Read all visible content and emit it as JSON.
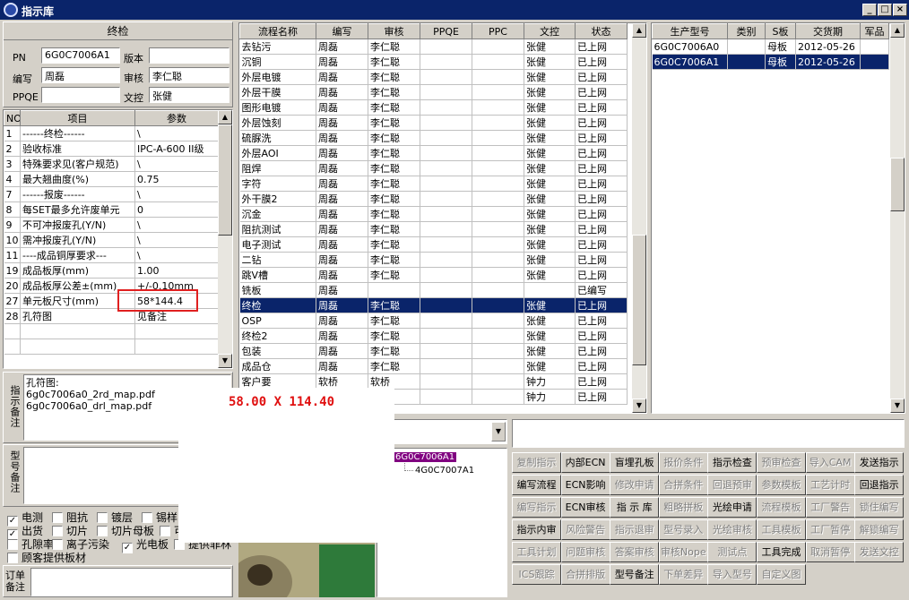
{
  "window": {
    "title": "指示库",
    "min": "_",
    "max": "□",
    "close": "×"
  },
  "left": {
    "section_title": "终检",
    "pn_label": "PN",
    "pn_value": "6G0C7006A1",
    "version_label": "版本",
    "version_value": "",
    "writer_label": "编写",
    "writer_value": "周磊",
    "review_label": "审核",
    "review_value": "李仁聪",
    "ppqe_label": "PPQE",
    "ppqe_value": "",
    "doc_label": "文控",
    "doc_value": "张健",
    "params_headers": [
      "NO",
      "项目",
      "参数"
    ],
    "params_rows": [
      [
        "1",
        "------终检------",
        "\\"
      ],
      [
        "2",
        "验收标准",
        "IPC-A-600 II级"
      ],
      [
        "3",
        "特殊要求见(客户规范)",
        "\\"
      ],
      [
        "4",
        "最大翘曲度(%)",
        "0.75"
      ],
      [
        "7",
        "------报废------",
        "\\"
      ],
      [
        "8",
        "每SET最多允许废单元",
        "0"
      ],
      [
        "9",
        "不可冲报废孔(Y/N)",
        "\\"
      ],
      [
        "10",
        "需冲报废孔(Y/N)",
        "\\"
      ],
      [
        "11",
        "----成品铜厚要求---",
        "\\"
      ],
      [
        "19",
        "成品板厚(mm)",
        "1.00"
      ],
      [
        "20",
        "成品板厚公差±(mm)",
        "+/-0.10mm"
      ],
      [
        "27",
        "单元板尺寸(mm)",
        "58*144.4"
      ],
      [
        "28",
        "孔符图",
        "见备注"
      ]
    ],
    "notes_label": "指示备注",
    "notes_lines": [
      "孔符图:",
      "6g0c7006a0_2rd_map.pdf",
      "6g0c7006a0_drl_map.pdf"
    ],
    "model_notes_label": "型号备注",
    "checkboxes_row1": [
      {
        "label": "电测",
        "checked": true
      },
      {
        "label": "阻抗",
        "checked": false
      },
      {
        "label": "镀层",
        "checked": false
      },
      {
        "label": "锡样",
        "checked": false
      }
    ],
    "checkboxes_row2": [
      {
        "label": "出货",
        "checked": true
      },
      {
        "label": "切片",
        "checked": false
      },
      {
        "label": "切片母板",
        "checked": false
      },
      {
        "label": "可",
        "checked": false
      }
    ],
    "checkboxes_row3": [
      {
        "label": "孔隙率",
        "checked": false
      },
      {
        "label": "离子污染",
        "checked": false
      },
      {
        "label": "光电板",
        "checked": true
      },
      {
        "label": "提供菲林",
        "checked": false
      }
    ],
    "checkbox_customer": {
      "label": "顾客提供板材",
      "checked": false
    },
    "order_notes_label": "订单备注"
  },
  "popup": {
    "text": "58.00 X 114.40"
  },
  "process": {
    "headers": [
      "流程名称",
      "编写",
      "审核",
      "PPQE",
      "PPC",
      "文控",
      "状态"
    ],
    "rows": [
      [
        "去钻污",
        "周磊",
        "李仁聪",
        "",
        "",
        "张健",
        "已上网"
      ],
      [
        "沉铜",
        "周磊",
        "李仁聪",
        "",
        "",
        "张健",
        "已上网"
      ],
      [
        "外层电镀",
        "周磊",
        "李仁聪",
        "",
        "",
        "张健",
        "已上网"
      ],
      [
        "外层干膜",
        "周磊",
        "李仁聪",
        "",
        "",
        "张健",
        "已上网"
      ],
      [
        "图形电镀",
        "周磊",
        "李仁聪",
        "",
        "",
        "张健",
        "已上网"
      ],
      [
        "外层蚀刻",
        "周磊",
        "李仁聪",
        "",
        "",
        "张健",
        "已上网"
      ],
      [
        "硫脲洗",
        "周磊",
        "李仁聪",
        "",
        "",
        "张健",
        "已上网"
      ],
      [
        "外层AOI",
        "周磊",
        "李仁聪",
        "",
        "",
        "张健",
        "已上网"
      ],
      [
        "阻焊",
        "周磊",
        "李仁聪",
        "",
        "",
        "张健",
        "已上网"
      ],
      [
        "字符",
        "周磊",
        "李仁聪",
        "",
        "",
        "张健",
        "已上网"
      ],
      [
        "外干膜2",
        "周磊",
        "李仁聪",
        "",
        "",
        "张健",
        "已上网"
      ],
      [
        "沉金",
        "周磊",
        "李仁聪",
        "",
        "",
        "张健",
        "已上网"
      ],
      [
        "阻抗测试",
        "周磊",
        "李仁聪",
        "",
        "",
        "张健",
        "已上网"
      ],
      [
        "电子测试",
        "周磊",
        "李仁聪",
        "",
        "",
        "张健",
        "已上网"
      ],
      [
        "二钻",
        "周磊",
        "李仁聪",
        "",
        "",
        "张健",
        "已上网"
      ],
      [
        "跳V槽",
        "周磊",
        "李仁聪",
        "",
        "",
        "张健",
        "已上网"
      ],
      [
        "铣板",
        "周磊",
        "",
        "",
        "",
        "",
        "已编写"
      ],
      [
        "终检",
        "周磊",
        "李仁聪",
        "",
        "",
        "张健",
        "已上网"
      ],
      [
        "OSP",
        "周磊",
        "李仁聪",
        "",
        "",
        "张健",
        "已上网"
      ],
      [
        "终检2",
        "周磊",
        "李仁聪",
        "",
        "",
        "张健",
        "已上网"
      ],
      [
        "包装",
        "周磊",
        "李仁聪",
        "",
        "",
        "张健",
        "已上网"
      ],
      [
        "成品仓",
        "周磊",
        "李仁聪",
        "",
        "",
        "张健",
        "已上网"
      ],
      [
        "客户要",
        "软桥",
        "软桥",
        "",
        "",
        "钟力",
        "已上网"
      ],
      [
        "",
        "",
        "",
        "",
        "",
        "钟力",
        "已上网"
      ]
    ],
    "selected_index": 17
  },
  "models": {
    "headers": [
      "生产型号",
      "类别",
      "S板",
      "交货期",
      "军品"
    ],
    "rows": [
      [
        "6G0C7006A0",
        "",
        "母板",
        "2012-05-26",
        ""
      ],
      [
        "6G0C7006A1",
        "",
        "母板",
        "2012-05-26",
        ""
      ]
    ],
    "selected_index": 1
  },
  "tree": {
    "root": "6G0C7006A1",
    "child": "4G0C7007A1"
  },
  "buttons": [
    [
      {
        "label": "复制指示",
        "enabled": false
      },
      {
        "label": "内部ECN",
        "enabled": true
      },
      {
        "label": "盲埋孔板",
        "enabled": true
      },
      {
        "label": "报价条件",
        "enabled": false
      },
      {
        "label": "指示检查",
        "enabled": true
      },
      {
        "label": "预审检查",
        "enabled": false
      },
      {
        "label": "导入CAM",
        "enabled": false
      },
      {
        "label": "发送指示",
        "enabled": true
      }
    ],
    [
      {
        "label": "编写流程",
        "enabled": true
      },
      {
        "label": "ECN影响",
        "enabled": true
      },
      {
        "label": "修改申请",
        "enabled": false
      },
      {
        "label": "合拼条件",
        "enabled": false
      },
      {
        "label": "回退预审",
        "enabled": false
      },
      {
        "label": "参数模板",
        "enabled": false
      },
      {
        "label": "工艺计时",
        "enabled": false
      },
      {
        "label": "回退指示",
        "enabled": true
      }
    ],
    [
      {
        "label": "编写指示",
        "enabled": false
      },
      {
        "label": "ECN审核",
        "enabled": true
      },
      {
        "label": "指 示 库",
        "enabled": true
      },
      {
        "label": "粗略拼板",
        "enabled": false
      },
      {
        "label": "光绘申请",
        "enabled": true
      },
      {
        "label": "流程模板",
        "enabled": false
      },
      {
        "label": "工厂警告",
        "enabled": false
      },
      {
        "label": "锁住编写",
        "enabled": false
      }
    ],
    [
      {
        "label": "指示内审",
        "enabled": true
      },
      {
        "label": "风险警告",
        "enabled": false
      },
      {
        "label": "指示退审",
        "enabled": false
      },
      {
        "label": "型号录入",
        "enabled": false
      },
      {
        "label": "光绘审核",
        "enabled": false
      },
      {
        "label": "工具模板",
        "enabled": false
      },
      {
        "label": "工厂暂停",
        "enabled": false
      },
      {
        "label": "解锁编写",
        "enabled": false
      }
    ],
    [
      {
        "label": "工具计划",
        "enabled": false
      },
      {
        "label": "问题审核",
        "enabled": false
      },
      {
        "label": "答案审核",
        "enabled": false
      },
      {
        "label": "审核Nope",
        "enabled": false
      },
      {
        "label": "测试点",
        "enabled": false
      },
      {
        "label": "工具完成",
        "enabled": true
      },
      {
        "label": "取消暂停",
        "enabled": false
      },
      {
        "label": "发送文控",
        "enabled": false
      }
    ],
    [
      {
        "label": "ICS跟踪",
        "enabled": false
      },
      {
        "label": "合拼排版",
        "enabled": false
      },
      {
        "label": "型号备注",
        "enabled": true
      },
      {
        "label": "下单差异",
        "enabled": false
      },
      {
        "label": "导入型号",
        "enabled": false
      },
      {
        "label": "自定义图",
        "enabled": false
      }
    ]
  ]
}
